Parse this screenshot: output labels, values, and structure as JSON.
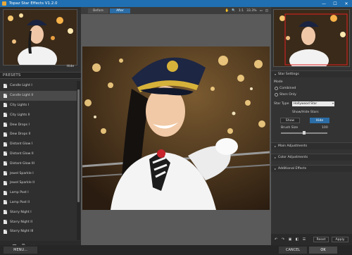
{
  "window": {
    "title": "Topaz Star Effects V1.2.0",
    "minimize": "—",
    "maximize": "☐",
    "close": "✕"
  },
  "left": {
    "hide_label": "Hide",
    "presets_title": "PRESETS",
    "presets": [
      {
        "label": "Candle Light I"
      },
      {
        "label": "Candle Light II",
        "selected": true
      },
      {
        "label": "City Lights I"
      },
      {
        "label": "City Lights II"
      },
      {
        "label": "Dew Drops I"
      },
      {
        "label": "Dew Drops II"
      },
      {
        "label": "Distant Glow I"
      },
      {
        "label": "Distant Glow II"
      },
      {
        "label": "Distant Glow III"
      },
      {
        "label": "Jewel Sparkle I"
      },
      {
        "label": "Jewel Sparkle II"
      },
      {
        "label": "Lamp Post I"
      },
      {
        "label": "Lamp Post II"
      },
      {
        "label": "Starry Night I"
      },
      {
        "label": "Starry Night II"
      },
      {
        "label": "Starry Night III"
      }
    ],
    "tools": [
      "+",
      "🗑",
      "⎘",
      "⇲"
    ]
  },
  "center": {
    "tabs": [
      "Before",
      "After"
    ],
    "active_tab": "After",
    "zoom": "33.3%",
    "one_to_one": "1:1"
  },
  "right": {
    "sections": {
      "star_settings": "Star Settings",
      "main_adjustments": "Main Adjustments",
      "color_adjustments": "Color Adjustments",
      "additional_effects": "Additional Effects"
    },
    "mode_label": "Mode",
    "mode_options": [
      "Combined",
      "Stars Only"
    ],
    "star_type_label": "Star Type",
    "star_type_value": "Hollywood Star",
    "show_hide_label": "Show/Hide Stars",
    "show_label": "Show",
    "hide_label": "Hide",
    "brush_size_label": "Brush Size",
    "brush_size_value": "100",
    "reset_label": "Reset",
    "apply_label": "Apply"
  },
  "bottom": {
    "menu_label": "MENU...",
    "cancel_label": "CANCEL",
    "ok_label": "OK"
  }
}
